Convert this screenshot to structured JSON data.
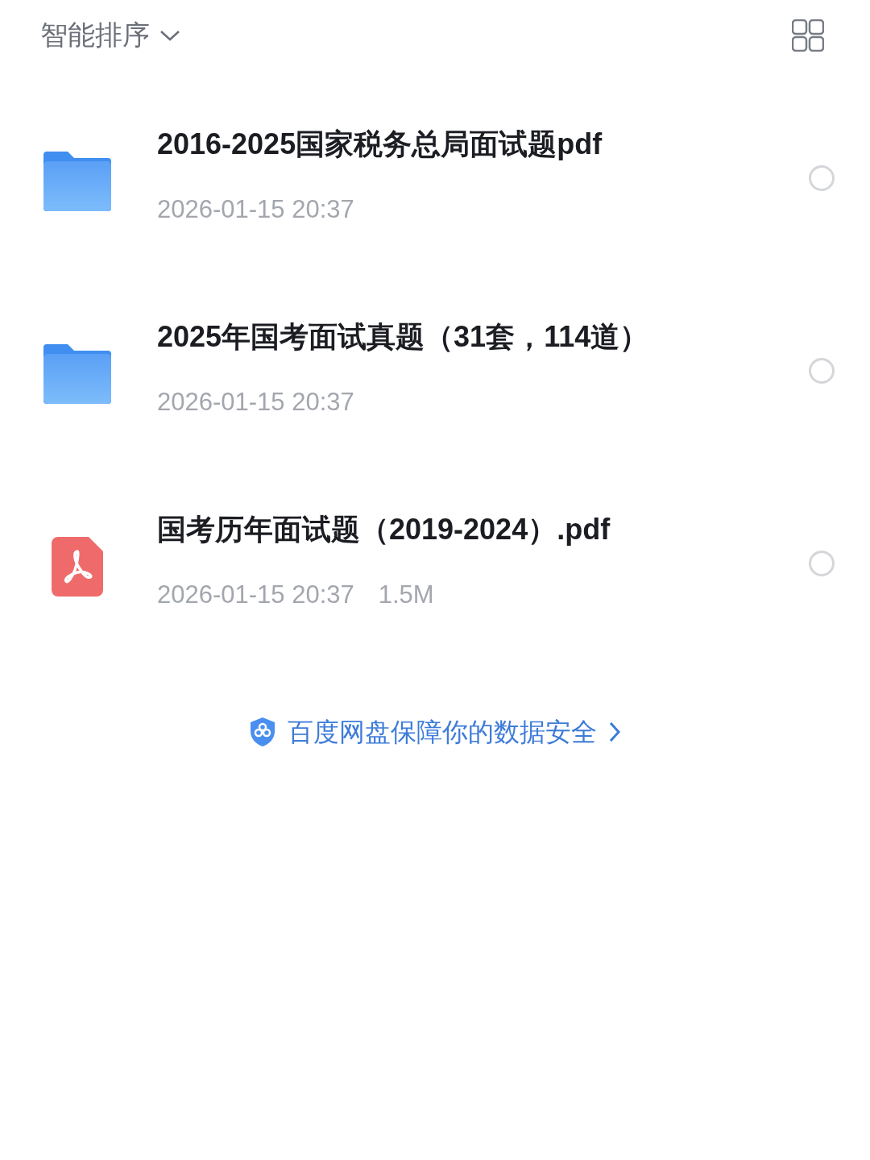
{
  "toolbar": {
    "sort_label": "智能排序"
  },
  "files": [
    {
      "kind": "folder",
      "name": "2016-2025国家税务总局面试题pdf",
      "date": "2026-01-15 20:37",
      "selected": false
    },
    {
      "kind": "folder",
      "name": "2025年国考面试真题（31套，114道）",
      "date": "2026-01-15 20:37",
      "selected": false
    },
    {
      "kind": "pdf",
      "name": "国考历年面试题（2019-2024）.pdf",
      "date": "2026-01-15 20:37",
      "size": "1.5M",
      "selected": false
    }
  ],
  "footer": {
    "text": "百度网盘保障你的数据安全"
  }
}
